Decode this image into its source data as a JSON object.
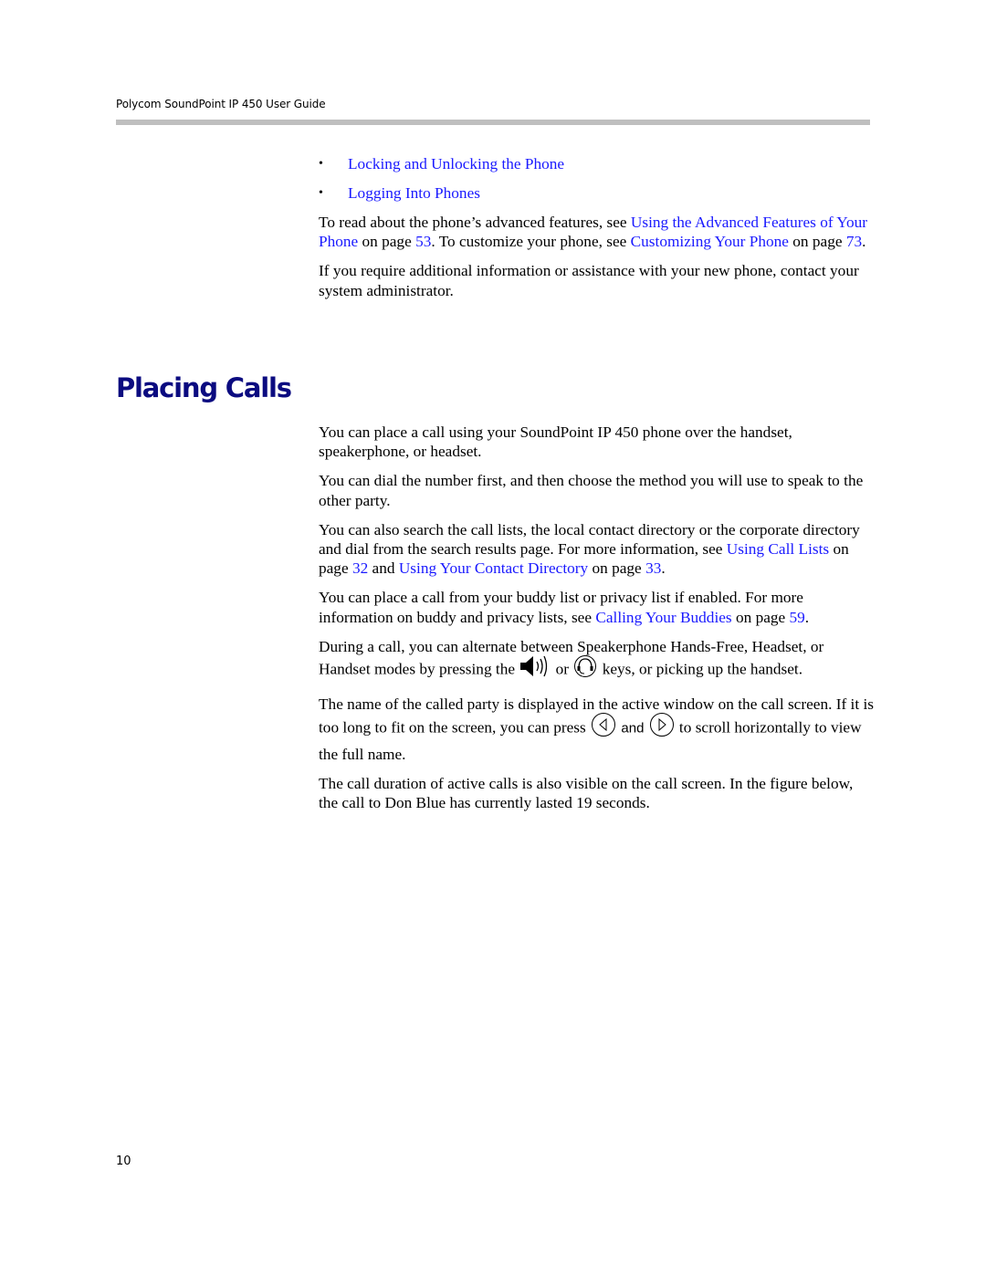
{
  "header": {
    "title": "Polycom SoundPoint IP 450 User Guide"
  },
  "bullets": [
    {
      "label": "Locking and Unlocking the Phone"
    },
    {
      "label": "Logging Into Phones"
    }
  ],
  "intro": {
    "p1": {
      "t1": "To read about the phone’s advanced features, see ",
      "link1": "Using the Advanced Features of Your Phone",
      "t2": " on page ",
      "page1": "53",
      "t3": ". To customize your phone, see ",
      "link2": "Customizing Your Phone",
      "t4": " on page ",
      "page2": "73",
      "t5": "."
    },
    "p2": "If you require additional information or assistance with your new phone, contact your system administrator."
  },
  "section": {
    "title": "Placing Calls",
    "p1": "You can place a call using your SoundPoint IP 450 phone over the handset, speakerphone, or headset.",
    "p2": "You can dial the number first, and then choose the method you will use to speak to the other party.",
    "p3": {
      "t1": "You can also search the call lists, the local contact directory or the corporate directory and dial from the search results page. For more information, see ",
      "link1": "Using Call Lists",
      "t2": " on page ",
      "page1": "32",
      "t3": " and ",
      "link2": "Using Your Contact Directory",
      "t4": " on page ",
      "page2": "33",
      "t5": "."
    },
    "p4": {
      "t1": "You can place a call from your buddy list or privacy list if enabled. For more information on buddy and privacy lists, see ",
      "link1": "Calling Your Buddies",
      "t2": " on page ",
      "page1": "59",
      "t3": "."
    },
    "p5": {
      "t1": "During a call, you can alternate between Speakerphone Hands-Free, Headset, or Handset modes by pressing the ",
      "icon1": "speaker-icon",
      "t2": " or ",
      "icon2": "headset-icon",
      "t3": " keys, or picking up the handset."
    },
    "p6": {
      "t1": "The name of the called party is displayed in the active window on the call screen. If it is too long to fit on the screen, you can press ",
      "icon1": "left-arrow-key-icon",
      "t2": " and ",
      "icon2": "right-arrow-key-icon",
      "t3": " to scroll horizontally to view the full name."
    },
    "p7": "The call duration of active calls is also visible on the call screen. In the figure below, the call to Don Blue has currently lasted 19 seconds."
  },
  "footer": {
    "page_number": "10"
  },
  "colors": {
    "link": "#1a1aff",
    "heading": "#0b0b80",
    "rule": "#bfbfbf"
  }
}
